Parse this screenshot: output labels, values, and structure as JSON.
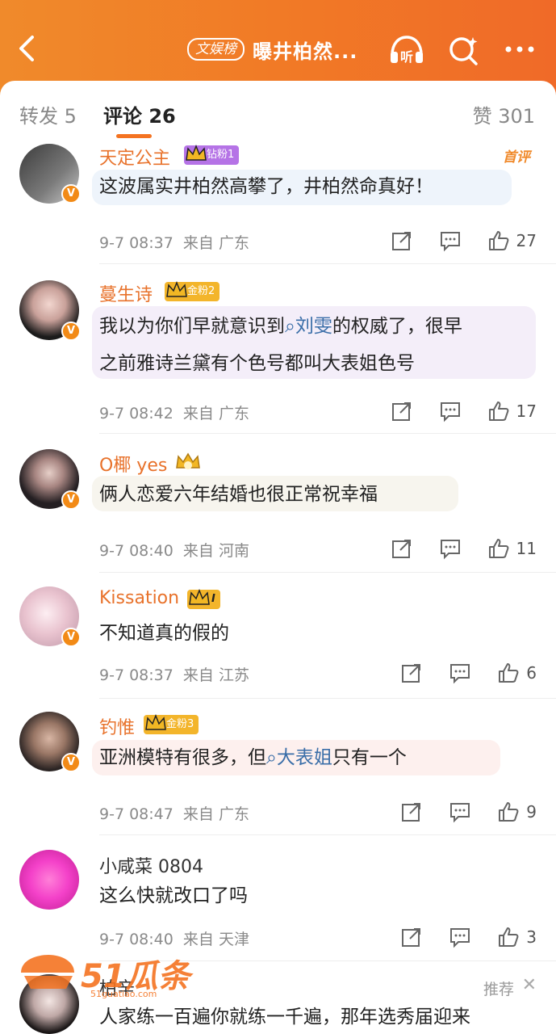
{
  "header": {
    "tag": "文娱榜",
    "title": "曝井柏然..."
  },
  "tabs": {
    "repost": "转发 5",
    "comment": "评论 26",
    "like": "赞 301"
  },
  "comments": [
    {
      "user": "天定公主",
      "badge": "钻粉1",
      "text": "这波属实井柏然高攀了，井柏然命真好！",
      "time": "9-7 08:37",
      "from": "来自 广东",
      "likes": "27",
      "tag": "首评"
    },
    {
      "user": "蔓生诗",
      "badge": "金粉2",
      "text1": "我以为你们早就意识到",
      "link": "刘雯",
      "text2": "的权威了，很早",
      "text3": "之前雅诗兰黛有个色号都叫大表姐色号",
      "time": "9-7 08:42",
      "from": "来自 广东",
      "likes": "17"
    },
    {
      "user": "O椰 yes",
      "text": "俩人恋爱六年结婚也很正常祝幸福",
      "time": "9-7 08:40",
      "from": "来自 河南",
      "likes": "11"
    },
    {
      "user": "Kissation",
      "badge": "I",
      "text": "不知道真的假的",
      "time": "9-7 08:37",
      "from": "来自 江苏",
      "likes": "6"
    },
    {
      "user": "钓惟",
      "badge": "金粉3",
      "text1": "亚洲模特有很多，但",
      "link": "大表姐",
      "text2": "只有一个",
      "time": "9-7 08:47",
      "from": "来自 广东",
      "likes": "9"
    },
    {
      "user": "小咸菜 0804",
      "text": "这么快就改口了吗",
      "time": "9-7 08:40",
      "from": "来自 天津",
      "likes": "3"
    },
    {
      "user": "柏辛",
      "text": "人家练一百遍你就练一千遍，那年选秀届迎来",
      "recommend": "推荐",
      "close": "✕"
    }
  ],
  "watermark": {
    "brand": "51瓜条",
    "url": "51guatiao.com"
  },
  "colors": {
    "accent": "#f47321",
    "header": "#f17a26",
    "username": "#e8722b",
    "link": "#3a6ea8"
  }
}
